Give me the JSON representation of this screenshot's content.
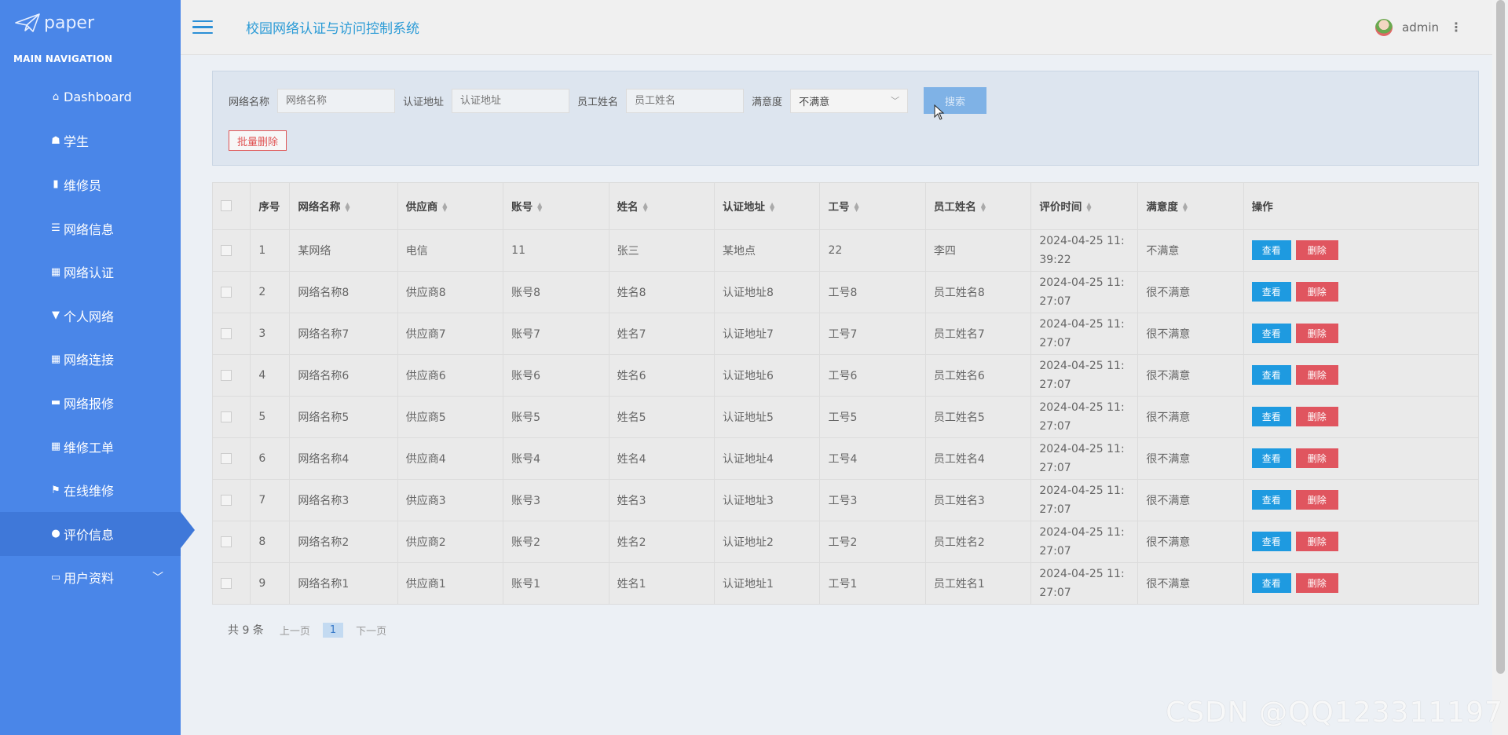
{
  "sidebar": {
    "logo_text": "paper",
    "nav_header": "MAIN NAVIGATION",
    "items": [
      {
        "label": "Dashboard",
        "icon": "home-icon",
        "glyph": "⌂"
      },
      {
        "label": "学生",
        "icon": "thumbs-up-icon",
        "glyph": "☗"
      },
      {
        "label": "维修员",
        "icon": "book-icon",
        "glyph": "▮"
      },
      {
        "label": "网络信息",
        "icon": "list-icon",
        "glyph": "☰"
      },
      {
        "label": "网络认证",
        "icon": "grid-icon",
        "glyph": "▦"
      },
      {
        "label": "个人网络",
        "icon": "thumbtack-icon",
        "glyph": "▼"
      },
      {
        "label": "网络连接",
        "icon": "grid-icon",
        "glyph": "▦"
      },
      {
        "label": "网络报修",
        "icon": "monitor-icon",
        "glyph": "▬"
      },
      {
        "label": "维修工单",
        "icon": "grid-icon",
        "glyph": "▦"
      },
      {
        "label": "在线维修",
        "icon": "flag-icon",
        "glyph": "⚑"
      },
      {
        "label": "评价信息",
        "icon": "user-icon",
        "glyph": "●"
      },
      {
        "label": "用户资料",
        "icon": "id-card-icon",
        "glyph": "▭"
      }
    ]
  },
  "header": {
    "title": "校园网络认证与访问控制系统",
    "username": "admin"
  },
  "search": {
    "network_name_label": "网络名称",
    "network_name_placeholder": "网络名称",
    "auth_addr_label": "认证地址",
    "auth_addr_placeholder": "认证地址",
    "staff_name_label": "员工姓名",
    "staff_name_placeholder": "员工姓名",
    "satisfaction_label": "满意度",
    "satisfaction_value": "不满意",
    "search_button": "搜索",
    "batch_delete_button": "批量删除"
  },
  "table": {
    "columns": [
      "序号",
      "网络名称",
      "供应商",
      "账号",
      "姓名",
      "认证地址",
      "工号",
      "员工姓名",
      "评价时间",
      "满意度",
      "操作"
    ],
    "view_label": "查看",
    "delete_label": "删除",
    "rows": [
      {
        "no": "1",
        "network": "某网络",
        "supplier": "电信",
        "account": "11",
        "name": "张三",
        "addr": "某地点",
        "staff_no": "22",
        "staff_name": "李四",
        "time": "2024-04-25 11:39:22",
        "satisfaction": "不满意"
      },
      {
        "no": "2",
        "network": "网络名称8",
        "supplier": "供应商8",
        "account": "账号8",
        "name": "姓名8",
        "addr": "认证地址8",
        "staff_no": "工号8",
        "staff_name": "员工姓名8",
        "time": "2024-04-25 11:27:07",
        "satisfaction": "很不满意"
      },
      {
        "no": "3",
        "network": "网络名称7",
        "supplier": "供应商7",
        "account": "账号7",
        "name": "姓名7",
        "addr": "认证地址7",
        "staff_no": "工号7",
        "staff_name": "员工姓名7",
        "time": "2024-04-25 11:27:07",
        "satisfaction": "很不满意"
      },
      {
        "no": "4",
        "network": "网络名称6",
        "supplier": "供应商6",
        "account": "账号6",
        "name": "姓名6",
        "addr": "认证地址6",
        "staff_no": "工号6",
        "staff_name": "员工姓名6",
        "time": "2024-04-25 11:27:07",
        "satisfaction": "很不满意"
      },
      {
        "no": "5",
        "network": "网络名称5",
        "supplier": "供应商5",
        "account": "账号5",
        "name": "姓名5",
        "addr": "认证地址5",
        "staff_no": "工号5",
        "staff_name": "员工姓名5",
        "time": "2024-04-25 11:27:07",
        "satisfaction": "很不满意"
      },
      {
        "no": "6",
        "network": "网络名称4",
        "supplier": "供应商4",
        "account": "账号4",
        "name": "姓名4",
        "addr": "认证地址4",
        "staff_no": "工号4",
        "staff_name": "员工姓名4",
        "time": "2024-04-25 11:27:07",
        "satisfaction": "很不满意"
      },
      {
        "no": "7",
        "network": "网络名称3",
        "supplier": "供应商3",
        "account": "账号3",
        "name": "姓名3",
        "addr": "认证地址3",
        "staff_no": "工号3",
        "staff_name": "员工姓名3",
        "time": "2024-04-25 11:27:07",
        "satisfaction": "很不满意"
      },
      {
        "no": "8",
        "network": "网络名称2",
        "supplier": "供应商2",
        "account": "账号2",
        "name": "姓名2",
        "addr": "认证地址2",
        "staff_no": "工号2",
        "staff_name": "员工姓名2",
        "time": "2024-04-25 11:27:07",
        "satisfaction": "很不满意"
      },
      {
        "no": "9",
        "network": "网络名称1",
        "supplier": "供应商1",
        "account": "账号1",
        "name": "姓名1",
        "addr": "认证地址1",
        "staff_no": "工号1",
        "staff_name": "员工姓名1",
        "time": "2024-04-25 11:27:07",
        "satisfaction": "很不满意"
      }
    ]
  },
  "pagination": {
    "total": "共 9 条",
    "prev": "上一页",
    "current": "1",
    "next": "下一页"
  },
  "watermark": "CSDN @QQ123311197",
  "colors": {
    "sidebar": "#4a86e8",
    "active": "#3f78d9",
    "title": "#2b9bd6",
    "view_btn": "#1e9ae0",
    "delete_btn": "#e0555f"
  }
}
